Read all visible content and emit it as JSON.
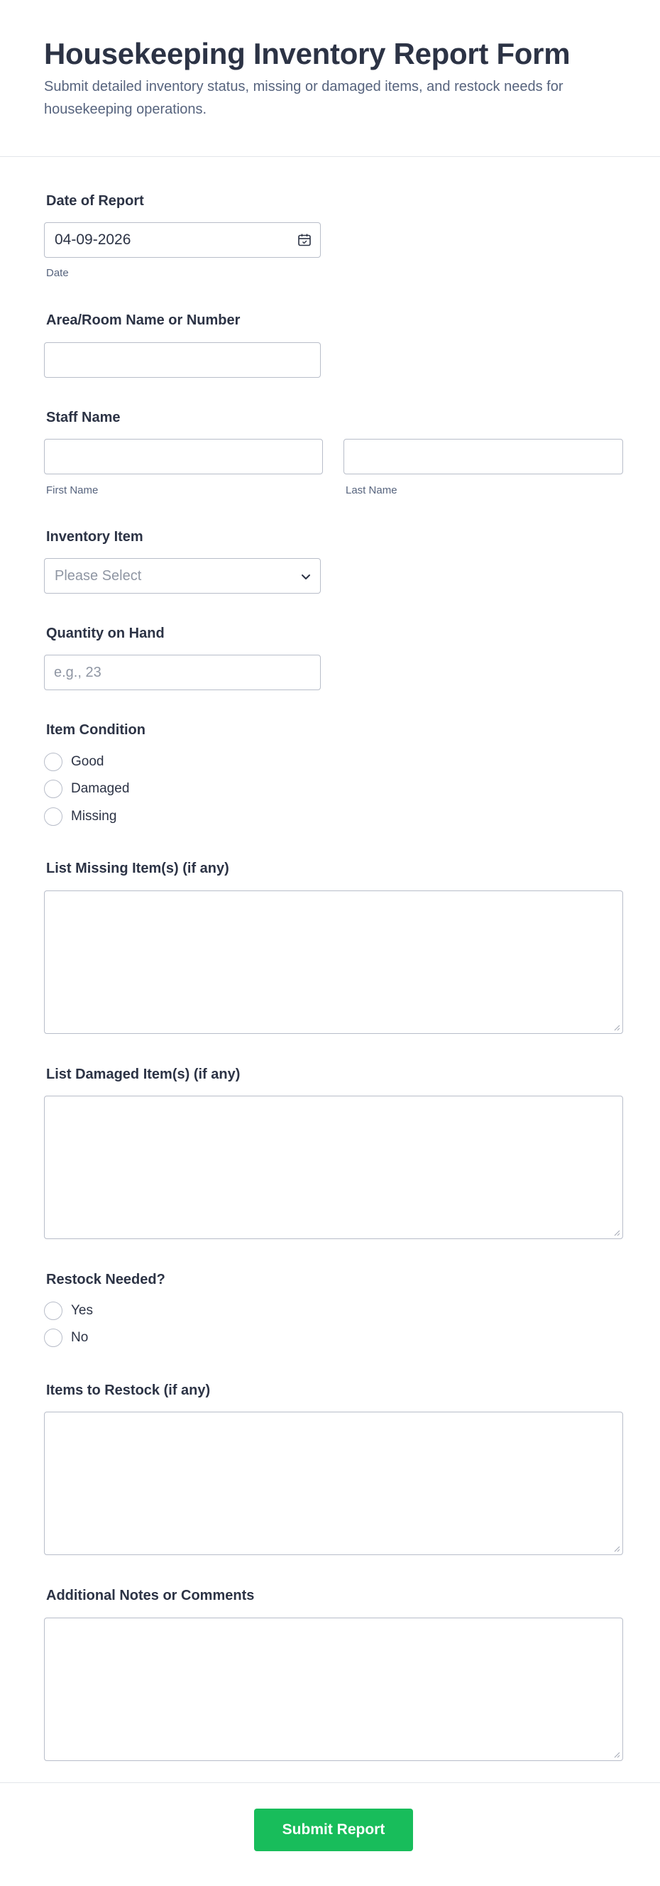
{
  "form": {
    "title": "Housekeeping Inventory Report Form",
    "subtitle": "Submit detailed inventory status, missing or damaged items, and restock needs for housekeeping operations."
  },
  "fields": {
    "date": {
      "label": "Date of Report",
      "value": "04-09-2026",
      "sublabel": "Date",
      "icon": "calendar-icon"
    },
    "area": {
      "label": "Area/Room Name or Number",
      "value": ""
    },
    "staff": {
      "label": "Staff Name",
      "first_sublabel": "First Name",
      "last_sublabel": "Last Name",
      "first_value": "",
      "last_value": ""
    },
    "inventory_item": {
      "label": "Inventory Item",
      "selected": "Please Select",
      "icon": "chevron-down-icon"
    },
    "quantity": {
      "label": "Quantity on Hand",
      "placeholder": "e.g., 23"
    },
    "condition": {
      "label": "Item Condition",
      "options": [
        "Good",
        "Damaged",
        "Missing"
      ]
    },
    "missing": {
      "label": "List Missing Item(s) (if any)"
    },
    "damaged": {
      "label": "List Damaged Item(s) (if any)"
    },
    "restock_needed": {
      "label": "Restock Needed?",
      "options": [
        "Yes",
        "No"
      ]
    },
    "restock_items": {
      "label": "Items to Restock (if any)"
    },
    "notes": {
      "label": "Additional Notes or Comments"
    }
  },
  "submit": {
    "label": "Submit Report",
    "color": "#18bd5b"
  },
  "colors": {
    "text": "#2c3345",
    "muted": "#57647e",
    "border": "#b8bdc9"
  }
}
